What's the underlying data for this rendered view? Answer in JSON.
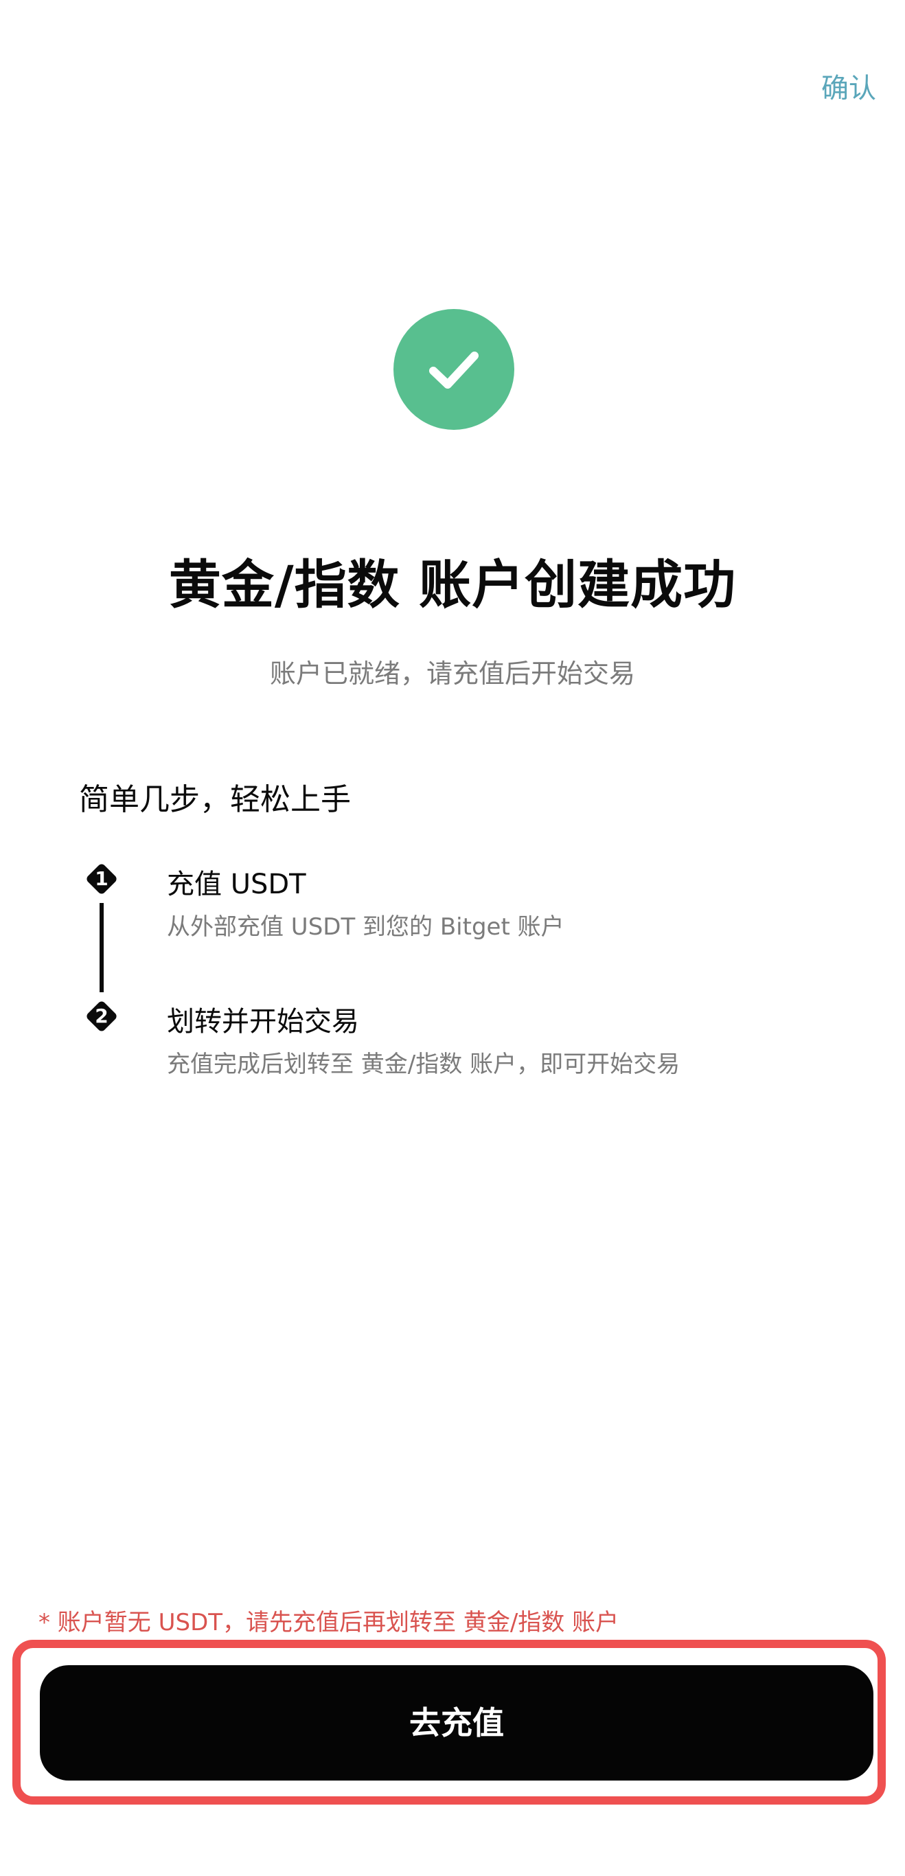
{
  "header": {
    "confirm_label": "确认"
  },
  "success": {
    "title": "黄金/指数 账户创建成功",
    "subtitle": "账户已就绪，请充值后开始交易",
    "accent_color": "#58bf8f"
  },
  "steps": {
    "heading": "简单几步，轻松上手",
    "items": [
      {
        "number": "1",
        "title": "充值 USDT",
        "description": "从外部充值 USDT 到您的 Bitget 账户"
      },
      {
        "number": "2",
        "title": "划转并开始交易",
        "description": "充值完成后划转至 黄金/指数 账户，即可开始交易"
      }
    ]
  },
  "footer": {
    "warning": "* 账户暂无 USDT，请先充值后再划转至 黄金/指数 账户",
    "cta_label": "去充值",
    "highlight_color": "#ef5050",
    "warning_color": "#d9534f"
  }
}
